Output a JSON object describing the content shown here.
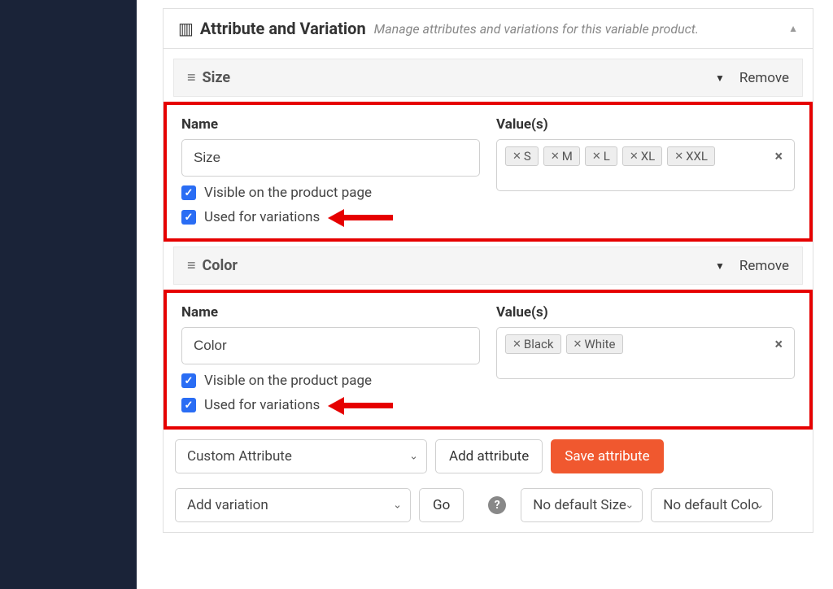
{
  "panel": {
    "title": "Attribute and Variation",
    "subtitle": "Manage attributes and variations for this variable product."
  },
  "attributes": [
    {
      "title": "Size",
      "remove": "Remove",
      "name_label": "Name",
      "name_value": "Size",
      "values_label": "Value(s)",
      "tags": [
        "S",
        "M",
        "L",
        "XL",
        "XXL"
      ],
      "visible_label": "Visible on the product page",
      "variations_label": "Used for variations"
    },
    {
      "title": "Color",
      "remove": "Remove",
      "name_label": "Name",
      "name_value": "Color",
      "values_label": "Value(s)",
      "tags": [
        "Black",
        "White"
      ],
      "visible_label": "Visible on the product page",
      "variations_label": "Used for variations"
    }
  ],
  "toolbar": {
    "custom_attr": "Custom Attribute",
    "add_attribute": "Add attribute",
    "save_attribute": "Save attribute",
    "add_variation": "Add variation",
    "go": "Go",
    "no_default_size": "No default Size",
    "no_default_color": "No default Colo"
  }
}
